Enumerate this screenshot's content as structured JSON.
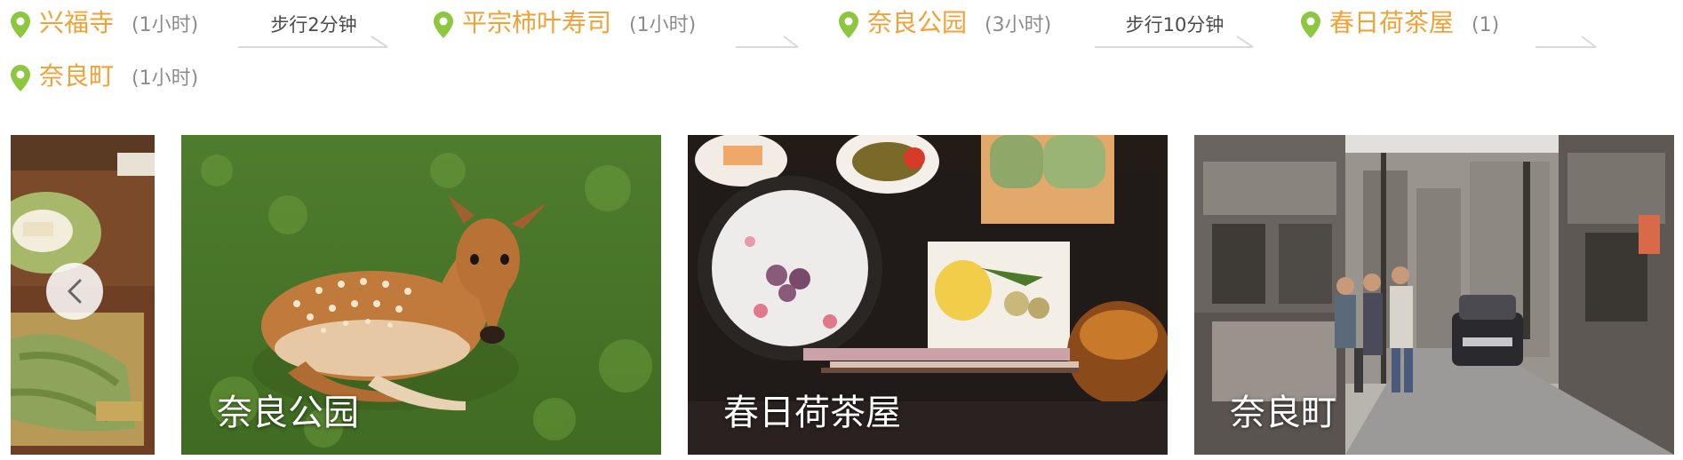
{
  "route": {
    "stops": [
      {
        "name": "兴福寺",
        "duration": "(1小时)"
      },
      {
        "name": "平宗柿叶寿司",
        "duration": "(1小时)"
      },
      {
        "name": "奈良公园",
        "duration": "(3小时)"
      },
      {
        "name": "春日荷茶屋",
        "duration": "(1)"
      },
      {
        "name": "奈良町",
        "duration": "(1小时)"
      }
    ],
    "connectors": [
      {
        "label": "步行2分钟"
      },
      {
        "label": ""
      },
      {
        "label": "步行10分钟"
      },
      {
        "label": ""
      }
    ],
    "colors": {
      "stop_name": "#f0a236",
      "pin": "#8dc63f",
      "duration": "#8c8c8c",
      "connector_line": "#d9d9d9"
    },
    "icons": {
      "pin": "map-pin-icon",
      "connector": "arrow-right-line-icon"
    }
  },
  "gallery": {
    "prev_icon": "chevron-left-icon",
    "cards": [
      {
        "caption": "",
        "scene": "food-tray-partial"
      },
      {
        "caption": "奈良公园",
        "scene": "deer-on-grass"
      },
      {
        "caption": "春日荷茶屋",
        "scene": "japanese-meal-tray"
      },
      {
        "caption": "奈良町",
        "scene": "old-town-street"
      }
    ]
  }
}
